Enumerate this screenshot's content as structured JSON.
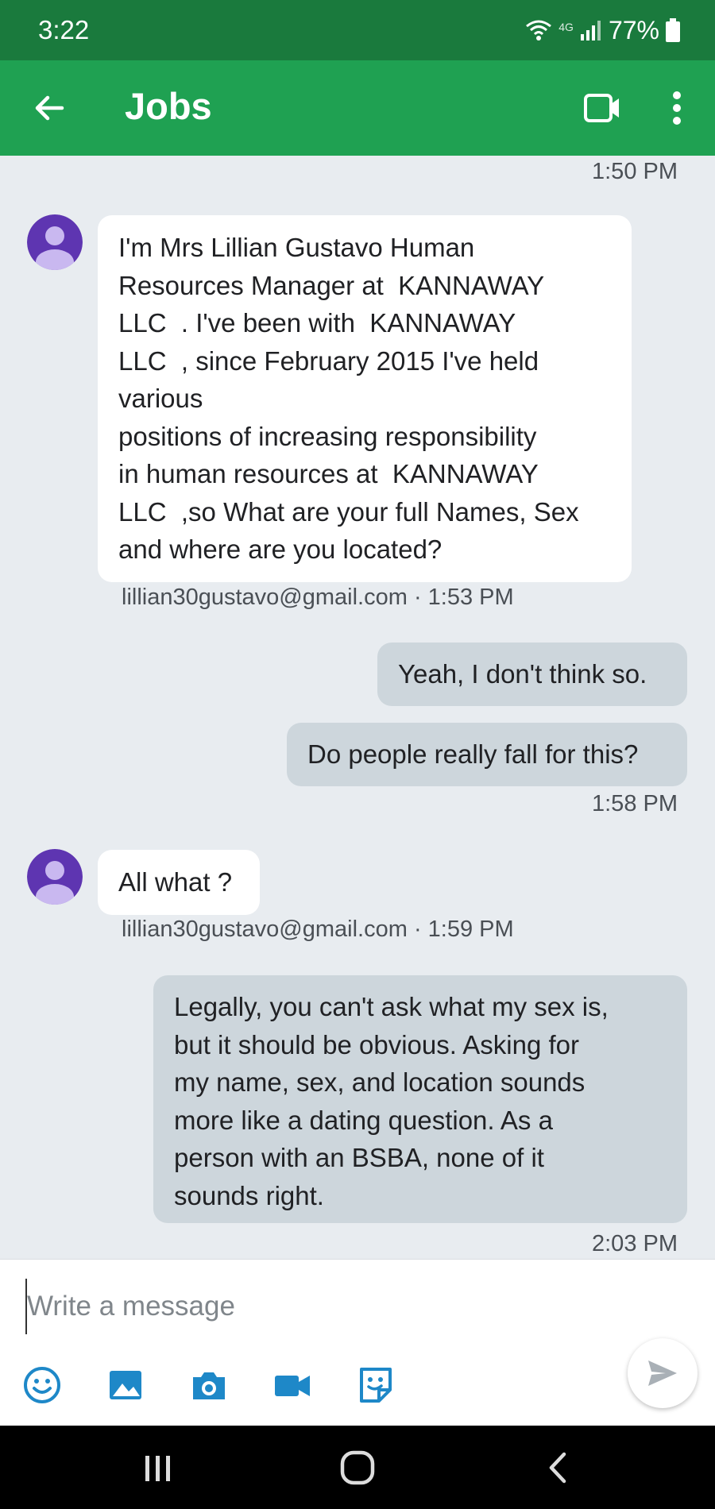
{
  "status_bar": {
    "time": "3:22",
    "network": "4G",
    "battery": "77%"
  },
  "app_bar": {
    "title": "Jobs",
    "icons": [
      "back-arrow-icon",
      "video-call-icon",
      "more-vert-icon"
    ]
  },
  "messages": [
    {
      "type": "timestamp",
      "text": "1:50 PM"
    },
    {
      "type": "incoming",
      "text": "I'm Mrs Lillian Gustavo Human\nResources Manager at  KANNAWAY\nLLC  . I've been with  KANNAWAY\nLLC  , since February 2015 I've held\nvarious\npositions of increasing responsibility\nin human resources at  KANNAWAY\nLLC  ,so What are your full Names, Sex\nand where are you located?",
      "meta": "lillian30gustavo@gmail.com · 1:53 PM"
    },
    {
      "type": "outgoing",
      "text": "Yeah, I don't think so."
    },
    {
      "type": "outgoing",
      "text": "Do people really fall for this?"
    },
    {
      "type": "timestamp",
      "text": "1:58 PM"
    },
    {
      "type": "incoming",
      "text": "All what ?",
      "meta": "lillian30gustavo@gmail.com · 1:59 PM"
    },
    {
      "type": "outgoing",
      "text": "Legally, you can't ask what my sex is,\nbut it should be obvious. Asking for\nmy name, sex, and location sounds\nmore like a dating question. As a\nperson with an BSBA, none of it\nsounds right."
    },
    {
      "type": "timestamp",
      "text": "2:03 PM"
    }
  ],
  "composer": {
    "placeholder": "Write a message",
    "tools": [
      "emoji-icon",
      "image-icon",
      "camera-icon",
      "video-icon",
      "sticker-icon"
    ]
  },
  "colors": {
    "status_bar": "#1a7a3d",
    "app_bar": "#1fa152",
    "chat_background": "#e8ecf0",
    "incoming_bubble": "#ffffff",
    "outgoing_bubble": "#cdd6dc",
    "avatar": "#5e35b1"
  }
}
